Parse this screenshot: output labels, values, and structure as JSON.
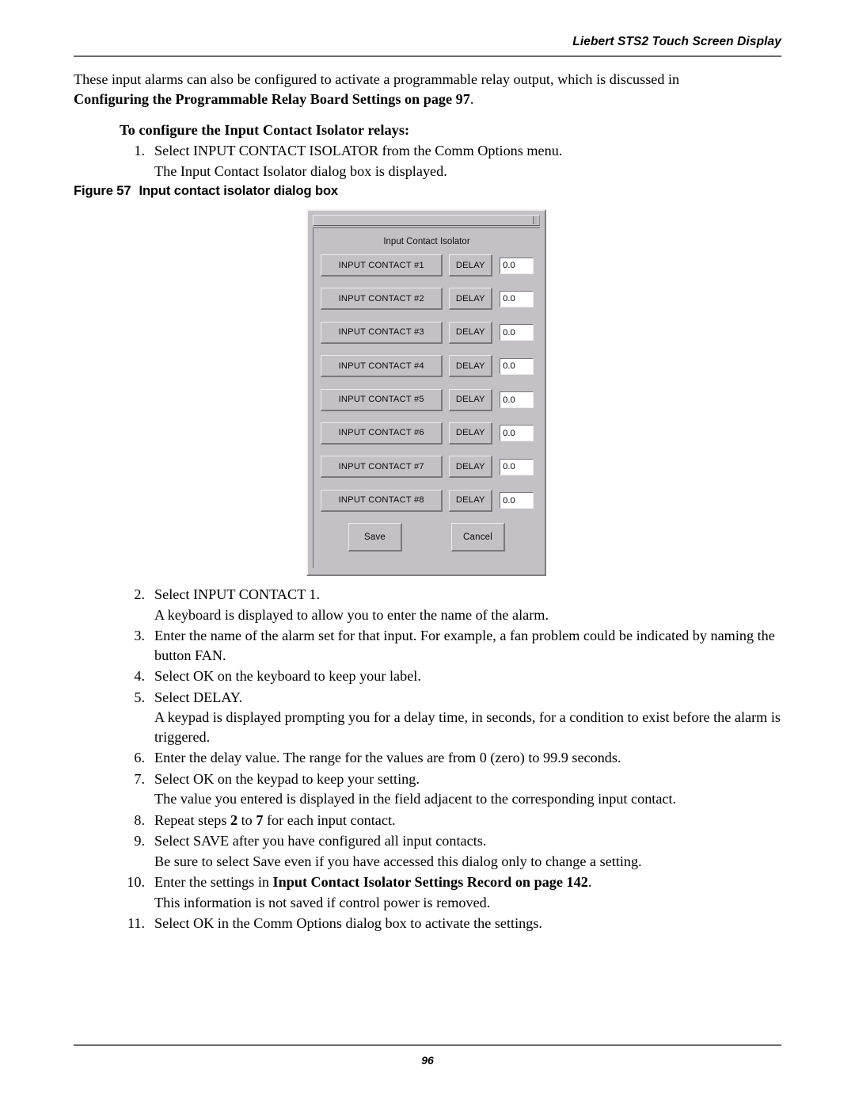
{
  "header": {
    "title": "Liebert STS2 Touch Screen Display"
  },
  "intro": {
    "text_before": "These input alarms can also be configured to activate a programmable relay output, which is discussed in ",
    "bold_ref": "Configuring the Programmable Relay Board Settings on page 97",
    "text_after": "."
  },
  "subhead": "To configure the Input Contact Isolator relays:",
  "figure": {
    "number": "Figure 57",
    "caption": "Input contact isolator dialog box"
  },
  "dialog": {
    "title": "Input Contact Isolator",
    "rows": [
      {
        "contact_label": "INPUT CONTACT #1",
        "delay_label": "DELAY",
        "delay_value": "0.0"
      },
      {
        "contact_label": "INPUT CONTACT #2",
        "delay_label": "DELAY",
        "delay_value": "0.0"
      },
      {
        "contact_label": "INPUT CONTACT #3",
        "delay_label": "DELAY",
        "delay_value": "0.0"
      },
      {
        "contact_label": "INPUT CONTACT #4",
        "delay_label": "DELAY",
        "delay_value": "0.0"
      },
      {
        "contact_label": "INPUT CONTACT #5",
        "delay_label": "DELAY",
        "delay_value": "0.0"
      },
      {
        "contact_label": "INPUT CONTACT #6",
        "delay_label": "DELAY",
        "delay_value": "0.0"
      },
      {
        "contact_label": "INPUT CONTACT #7",
        "delay_label": "DELAY",
        "delay_value": "0.0"
      },
      {
        "contact_label": "INPUT CONTACT #8",
        "delay_label": "DELAY",
        "delay_value": "0.0"
      }
    ],
    "save_label": "Save",
    "cancel_label": "Cancel"
  },
  "steps_top": [
    {
      "num": "1.",
      "text": "Select INPUT CONTACT ISOLATOR from the Comm Options menu.",
      "sub": "The Input Contact Isolator dialog box is displayed."
    }
  ],
  "steps_bottom": [
    {
      "num": "2.",
      "text": "Select INPUT CONTACT 1.",
      "sub": "A keyboard is displayed to allow you to enter the name of the alarm."
    },
    {
      "num": "3.",
      "text": "Enter the name of the alarm set for that input. For example, a fan problem could be indicated by naming the button FAN.",
      "sub": ""
    },
    {
      "num": "4.",
      "text": "Select OK on the keyboard to keep your label.",
      "sub": ""
    },
    {
      "num": "5.",
      "text": "Select DELAY.",
      "sub": "A keypad is displayed prompting you for a delay time, in seconds, for a condition to exist before the alarm is triggered."
    },
    {
      "num": "6.",
      "text": "Enter the delay value. The range for the values are from 0 (zero) to 99.9 seconds.",
      "sub": ""
    },
    {
      "num": "7.",
      "text": "Select OK on the keypad to keep your setting.",
      "sub": "The value you entered is displayed in the field adjacent to the corresponding input contact."
    },
    {
      "num": "8.",
      "text_parts": [
        {
          "t": "Repeat steps ",
          "b": false
        },
        {
          "t": "2",
          "b": true
        },
        {
          "t": " to ",
          "b": false
        },
        {
          "t": "7",
          "b": true
        },
        {
          "t": " for each input contact.",
          "b": false
        }
      ],
      "sub": ""
    },
    {
      "num": "9.",
      "text": "Select SAVE after you have configured all input contacts.",
      "sub": "Be sure to select Save even if you have accessed this dialog only to change a setting."
    },
    {
      "num": "10.",
      "text_parts": [
        {
          "t": "Enter the settings in ",
          "b": false
        },
        {
          "t": "Input Contact Isolator Settings Record on page 142",
          "b": true
        },
        {
          "t": ".",
          "b": false
        }
      ],
      "sub": "This information is not saved if control power is removed."
    },
    {
      "num": "11.",
      "text": "Select OK in the Comm Options dialog box to activate the settings.",
      "sub": ""
    }
  ],
  "footer": {
    "page_number": "96"
  }
}
